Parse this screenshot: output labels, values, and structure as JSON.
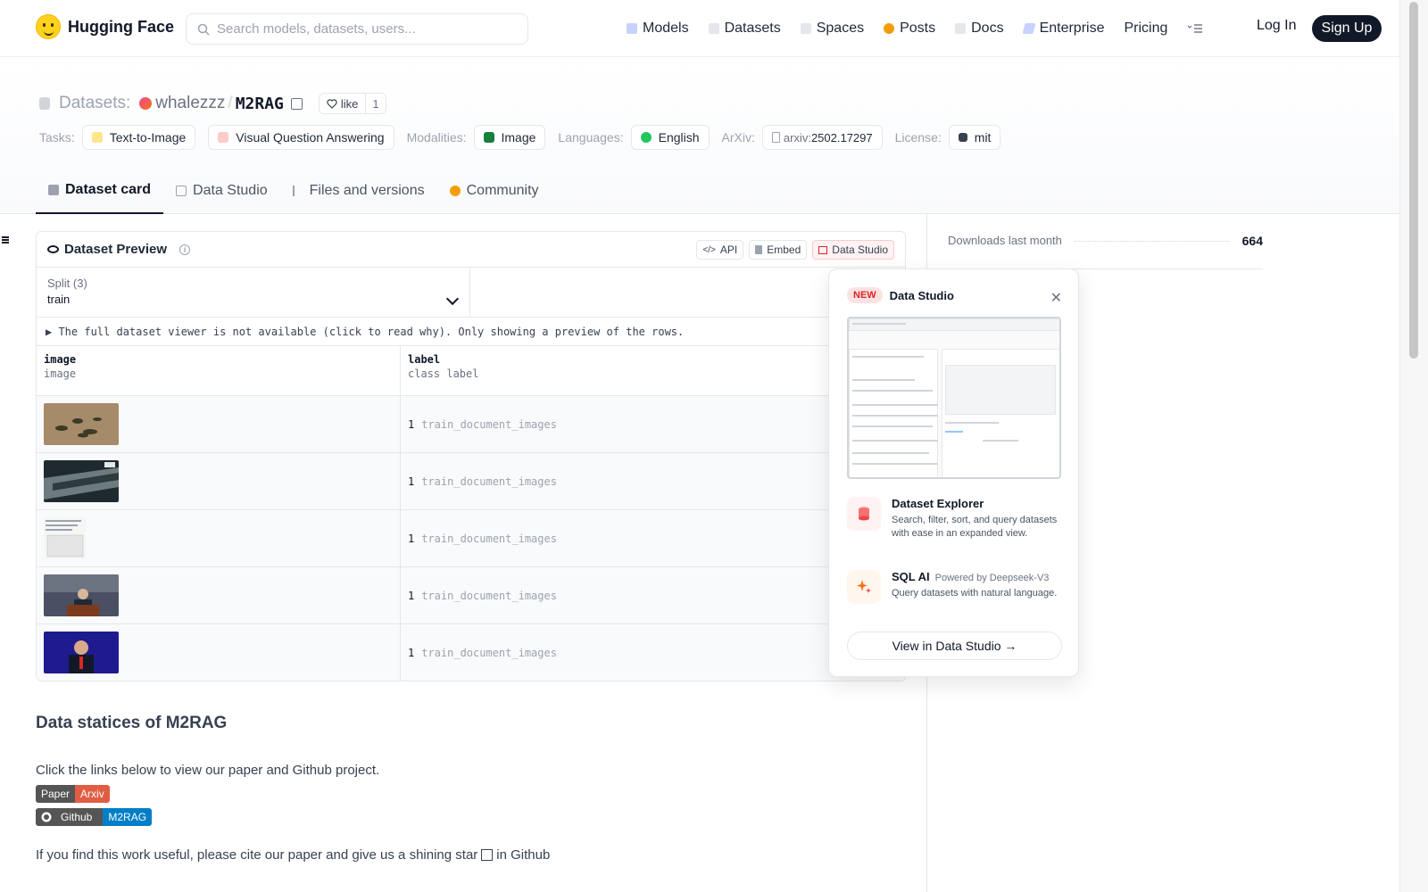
{
  "nav": {
    "brand": "Hugging Face",
    "search_placeholder": "Search models, datasets, users...",
    "links": [
      "Models",
      "Datasets",
      "Spaces",
      "Posts",
      "Docs",
      "Enterprise",
      "Pricing"
    ],
    "login": "Log In",
    "signup": "Sign Up"
  },
  "header": {
    "section": "Datasets:",
    "owner": "whalezzz",
    "slash": "/",
    "repo": "M2RAG",
    "like_label": "like",
    "like_count": "1",
    "tasks_label": "Tasks:",
    "tasks": [
      "Text-to-Image",
      "Visual Question Answering"
    ],
    "modalities_label": "Modalities:",
    "modalities": [
      "Image"
    ],
    "languages_label": "Languages:",
    "languages": [
      "English"
    ],
    "arxiv_label": "ArXiv:",
    "arxiv_prefix": "arxiv:",
    "arxiv_id": "2502.17297",
    "license_label": "License:",
    "license": "mit",
    "tabs": [
      "Dataset card",
      "Data Studio",
      "Files and versions",
      "Community"
    ]
  },
  "preview": {
    "title": "Dataset Preview",
    "info": "i",
    "btn_api": "API",
    "btn_embed": "Embed",
    "btn_studio": "Data Studio",
    "split_label": "Split (3)",
    "split_value": "train",
    "notice": "▶ The full dataset viewer is not available (click to read why). Only showing a preview of the rows.",
    "columns": [
      {
        "name": "image",
        "type": "image"
      },
      {
        "name": "label",
        "type": "class label"
      }
    ],
    "rows": [
      {
        "value": "1",
        "label": "train_document_images"
      },
      {
        "value": "1",
        "label": "train_document_images"
      },
      {
        "value": "1",
        "label": "train_document_images"
      },
      {
        "value": "1",
        "label": "train_document_images"
      },
      {
        "value": "1",
        "label": "train_document_images"
      }
    ]
  },
  "sidebar": {
    "downloads_label": "Downloads last month",
    "downloads_value": "664"
  },
  "popover": {
    "badge": "NEW",
    "title": "Data Studio",
    "close": "✕",
    "f1_title": "Dataset Explorer",
    "f1_desc": "Search, filter, sort, and query datasets with ease in an expanded view.",
    "f2_title": "SQL AI",
    "f2_powered": "Powered by Deepseek-V3",
    "f2_desc": "Query datasets with natural language.",
    "cta": "View in Data Studio →"
  },
  "body": {
    "heading": "Data statices of M2RAG",
    "p1": "Click the links below to view our paper and Github project.",
    "badge1_left": "Paper",
    "badge1_right": "Arxiv",
    "badge2_left": "Github",
    "badge2_right": "M2RAG",
    "p2_before": "If you find this work useful, please cite our paper and give us a shining star",
    "p2_after": "in Github"
  },
  "colors": {
    "accent_dark": "#111827",
    "badge_new": "#dc2626",
    "arxiv_red": "#b31b1b",
    "github_blue": "#1f6feb"
  }
}
